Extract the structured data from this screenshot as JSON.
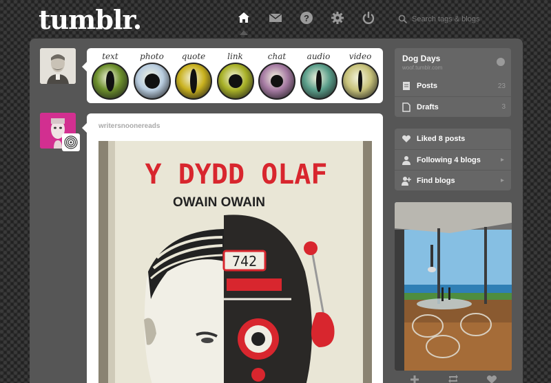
{
  "header": {
    "logo": "tumblr.",
    "search": {
      "placeholder": "Search tags & blogs",
      "value": ""
    }
  },
  "post_types": [
    {
      "label": "text",
      "iris": "#6c8f2c",
      "pupil_w": 12,
      "pupil_h": 30
    },
    {
      "label": "photo",
      "iris": "#b9cde0",
      "pupil_w": 22,
      "pupil_h": 22
    },
    {
      "label": "quote",
      "iris": "#c9b11e",
      "pupil_w": 10,
      "pupil_h": 36
    },
    {
      "label": "link",
      "iris": "#a8b127",
      "pupil_w": 20,
      "pupil_h": 20
    },
    {
      "label": "chat",
      "iris": "#a67ba3",
      "pupil_w": 18,
      "pupil_h": 18
    },
    {
      "label": "audio",
      "iris": "#5a9e8a",
      "pupil_w": 8,
      "pupil_h": 32
    },
    {
      "label": "video",
      "iris": "#c7c27a",
      "pupil_w": 6,
      "pupil_h": 32
    }
  ],
  "post": {
    "author": "writersnoonereads",
    "book_title": "Y DYDD OLAF",
    "book_author": "OWAIN OWAIN",
    "book_number": "742"
  },
  "sidebar": {
    "blog": {
      "name": "Dog Days",
      "url": "woof.tumblr.com",
      "posts_label": "Posts",
      "posts_count": "23",
      "drafts_label": "Drafts",
      "drafts_count": "3"
    },
    "social": {
      "liked_label": "Liked 8 posts",
      "following_label": "Following 4 blogs",
      "find_label": "Find blogs"
    }
  },
  "colors": {
    "background": "#2b2b2b",
    "panel": "#565656",
    "sidebar_item": "#666666",
    "book_red": "#d8262e"
  }
}
